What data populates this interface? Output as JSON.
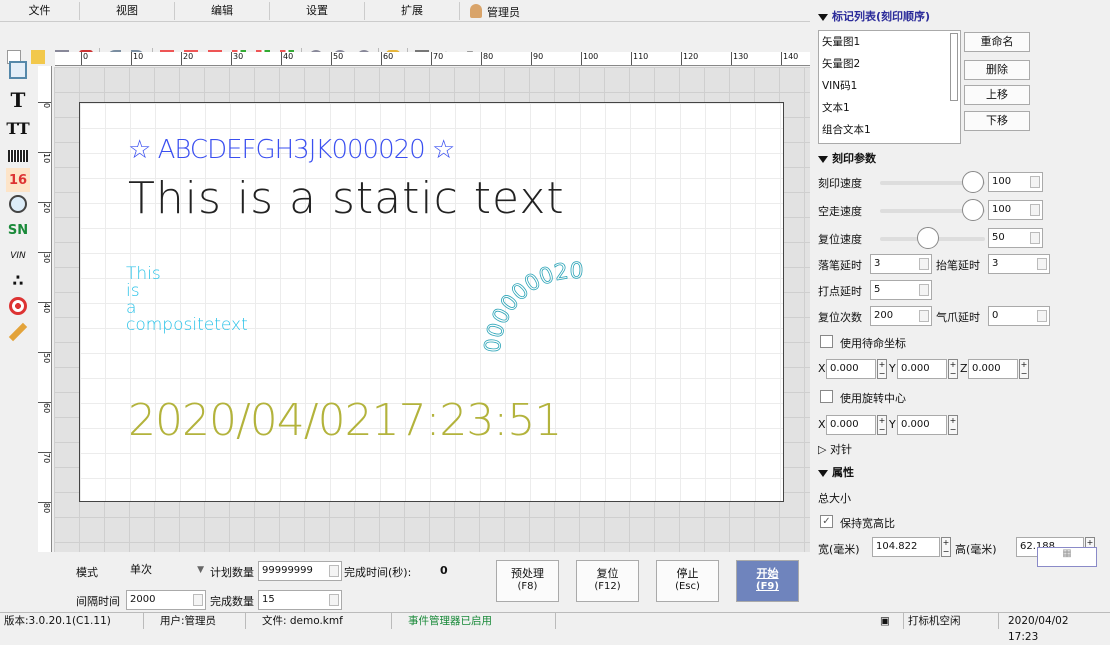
{
  "menu": [
    "文件",
    "视图",
    "编辑",
    "设置",
    "扩展",
    "管理员"
  ],
  "ruler_h": [
    "0",
    "10",
    "20",
    "30",
    "40",
    "50",
    "60",
    "70",
    "80",
    "90",
    "100",
    "110",
    "120",
    "130",
    "140"
  ],
  "ruler_v": [
    "0",
    "10",
    "20",
    "30",
    "40",
    "50",
    "60",
    "70",
    "80"
  ],
  "left_tools": [
    "T",
    "TT",
    "16",
    "SN",
    "VIN",
    "∴"
  ],
  "canvas": {
    "vector_text": "☆ ABCDEFGH3JK000020 ☆",
    "static_text": "This is a static text",
    "composite_lines": [
      "This",
      "is",
      "a",
      "compositetext"
    ],
    "arc_text": "000000020",
    "date_text": "2020/04/0217:23:51"
  },
  "colors": {
    "vector": "#3a4ff0",
    "static": "#222222",
    "composite": "#29c2e8",
    "arc": "#2fa6b9",
    "date": "#b3b33c",
    "start_btn": "#6f84bd"
  },
  "marklist": {
    "header": "标记列表(刻印顺序)",
    "items": [
      "矢量图1",
      "矢量图2",
      "VIN码1",
      "文本1",
      "组合文本1"
    ],
    "btn_rename": "重命名",
    "btn_delete": "删除",
    "btn_up": "上移",
    "btn_down": "下移"
  },
  "params": {
    "header": "刻印参数",
    "speed_label": "刻印速度",
    "speed_val": "100",
    "idle_label": "空走速度",
    "idle_val": "100",
    "reset_label": "复位速度",
    "reset_val": "50",
    "pen_down_label": "落笔延时",
    "pen_down_val": "3",
    "pen_up_label": "抬笔延时",
    "pen_up_val": "3",
    "dot_label": "打点延时",
    "dot_val": "5",
    "reset_count_label": "复位次数",
    "reset_count_val": "200",
    "claw_label": "气爪延时",
    "claw_val": "0",
    "use_standby": "使用待命坐标",
    "x_label": "X",
    "y_label": "Y",
    "z_label": "Z",
    "x_val": "0.000",
    "y_val": "0.000",
    "z_val": "0.000",
    "use_rotation": "使用旋转中心",
    "rx_val": "0.000",
    "ry_val": "0.000",
    "align": "▷ 对针"
  },
  "attr": {
    "header": "属性",
    "size_label": "总大小",
    "keep_ratio": "保持宽高比",
    "check": "✓",
    "w_label": "宽(毫米)",
    "w_val": "104.822",
    "h_label": "高(毫米)",
    "h_val": "62.188"
  },
  "bottom": {
    "mode_label": "模式",
    "mode_val": "单次",
    "plan_label": "计划数量",
    "plan_val": "99999999",
    "done_time_label": "完成时间(秒):",
    "done_time_val": "0",
    "interval_label": "间隔时间",
    "interval_val": "2000",
    "done_count_label": "完成数量",
    "done_count_val": "15",
    "btn_pre": "预处理",
    "btn_pre_key": "(F8)",
    "btn_reset": "复位",
    "btn_reset_key": "(F12)",
    "btn_stop": "停止",
    "btn_stop_key": "(Esc)",
    "btn_start": "开始",
    "btn_start_key": "(F9)"
  },
  "status": {
    "version": "版本:3.0.20.1(C1.11)",
    "user": "用户:管理员",
    "file": "文件: demo.kmf",
    "event": "事件管理器已启用",
    "machine": "打标机空闲",
    "time": "2020/04/02 17:23"
  }
}
